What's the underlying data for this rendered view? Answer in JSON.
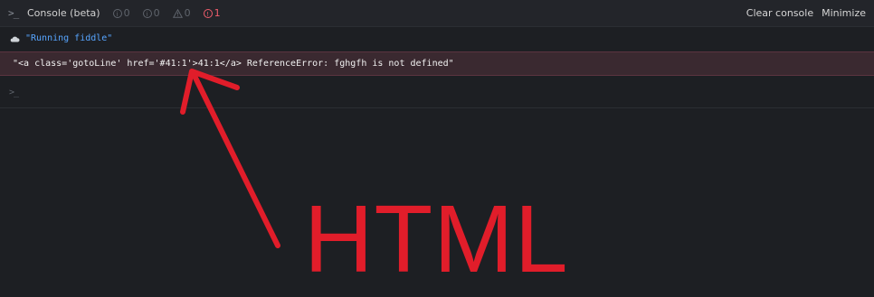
{
  "header": {
    "prompt_glyph": ">_",
    "title": "Console (beta)",
    "counters": [
      {
        "icon": "info-circle-icon",
        "value": "0"
      },
      {
        "icon": "info-circle-icon",
        "value": "0"
      },
      {
        "icon": "warning-triangle-icon",
        "value": "0"
      },
      {
        "icon": "error-circle-icon",
        "value": "1"
      }
    ],
    "clear_label": "Clear console",
    "minimize_label": "Minimize"
  },
  "messages": {
    "info": "\"Running fiddle\"",
    "error": "\"<a class='gotoLine' href='#41:1'>41:1</a> ReferenceError: fghgfh is not defined\""
  },
  "input": {
    "prompt_glyph": ">_"
  },
  "annotation": {
    "text": "HTML",
    "color": "#e11d2a"
  },
  "colors": {
    "background": "#1d1f23",
    "info_text": "#57a5ff",
    "error_bg": "#3a2930",
    "error_count": "#f05d6c"
  }
}
